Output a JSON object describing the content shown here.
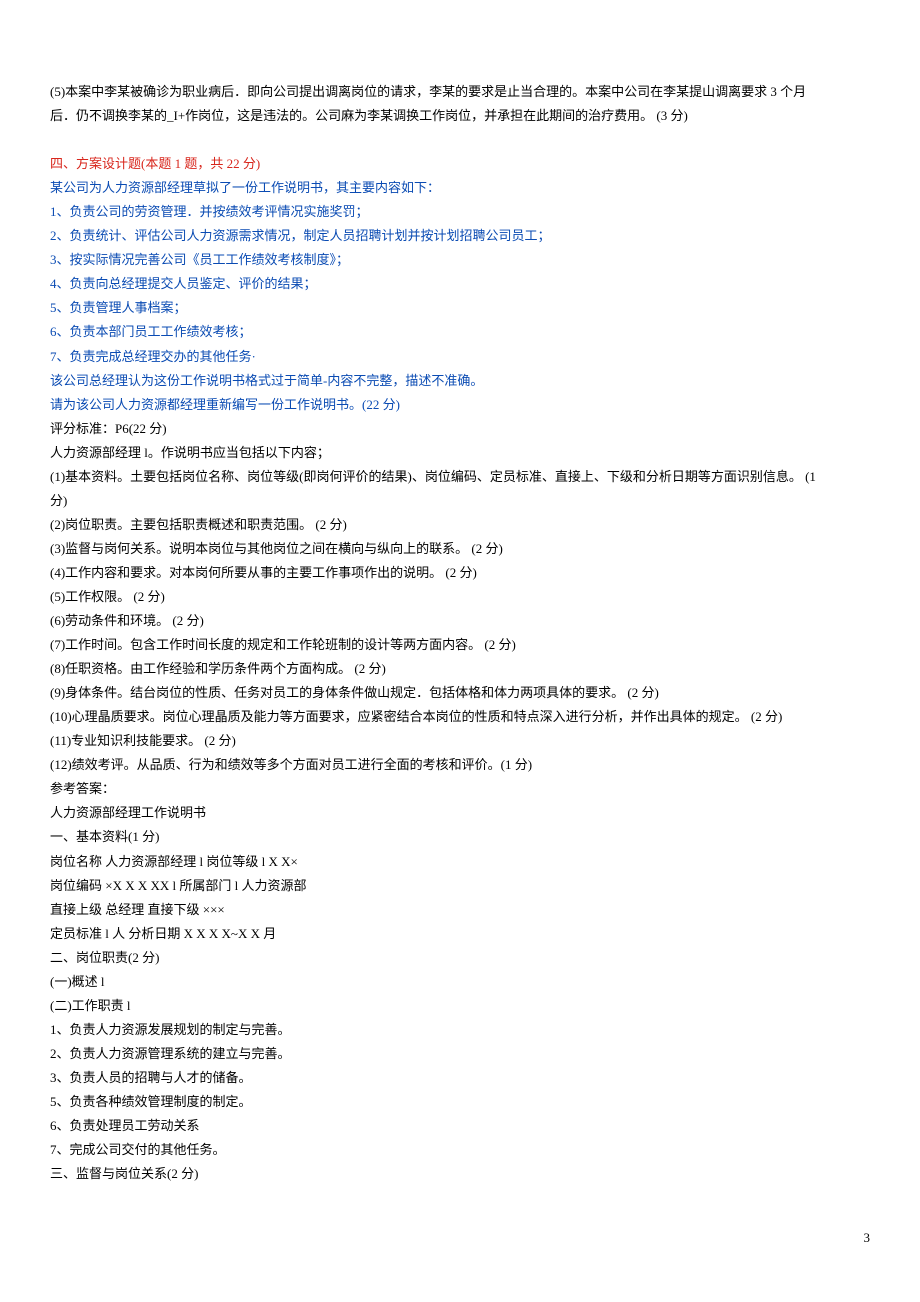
{
  "intro_l1": "(5)本案中李某被确诊为职业病后．即向公司提出调离岗位的请求，李某的要求是止当合理的。本案中公司在李某提山调离要求 3 个月",
  "intro_l2": "后．仍不调换李某的_I+作岗位，这是违法的。公司麻为李某调换工作岗位，并承担在此期间的治疗费用。 (3 分)",
  "section4_title": "四、方案设计题(本题 1 题，共 22 分)",
  "s4_p1": "某公司为人力资源部经理草拟了一份工作说明书，其主要内容如下：",
  "s4_i1": "1、负责公司的劳资管理．并按绩效考评情况实施奖罚；",
  "s4_i2": "2、负责统计、评估公司人力资源需求情况，制定人员招聘计划并按计划招聘公司员工；",
  "s4_i3": "3、按实际情况完善公司《员工工作绩效考核制度》；",
  "s4_i4": "4、负责向总经理提交人员鉴定、评价的结果；",
  "s4_i5": "5、负责管理人事档案；",
  "s4_i6": "6、负责本部门员工工作绩效考核；",
  "s4_i7": "7、负责完成总经理交办的其他任务·",
  "s4_p2": "该公司总经理认为这份工作说明书格式过于简单-内容不完整，描述不准确。",
  "s4_p3": "请为该公司人力资源都经理重新编写一份工作说明书。(22 分)",
  "std_title": "评分标准：P6(22 分)",
  "std_p1": "人力资源部经理 l。作说明书应当包括以下内容；",
  "std_i1a": "(1)基本资料。土要包括岗位名称、岗位等级(即岗何评价的结果)、岗位编码、定员标准、直接上、下级和分析日期等方面识别信息。 (1",
  "std_i1b": "分)",
  "std_i2": "(2)岗位职责。主要包括职责概述和职责范围。 (2 分)",
  "std_i3": "(3)监督与岗何关系。说明本岗位与其他岗位之间在横向与纵向上的联系。 (2 分)",
  "std_i4": "(4)工作内容和要求。对本岗何所要从事的主要工作事项作出的说明。 (2 分)",
  "std_i5": "(5)工作权限。 (2 分)",
  "std_i6": "(6)劳动条件和环境。 (2 分)",
  "std_i7": "(7)工作时间。包含工作时间长度的规定和工作轮班制的设计等两方面内容。 (2 分)",
  "std_i8": "(8)任职资格。由工作经验和学历条件两个方面构成。 (2 分)",
  "std_i9": "(9)身体条件。结台岗位的性质、任务对员工的身体条件做山规定．包括体格和体力两项具体的要求。 (2 分)",
  "std_i10": "(10)心理晶质要求。岗位心理晶质及能力等方面要求，应紧密结合本岗位的性质和特点深入进行分析，并作出具体的规定。 (2 分)",
  "std_i11": "(11)专业知识利技能要求。 (2 分)",
  "std_i12": "(12)绩效考评。从品质、行为和绩效等多个方面对员工进行全面的考核和评价。(1 分)",
  "ans_title": "参考答案：",
  "ans_p1": "人力资源部经理工作说明书",
  "ans_s1": "一、基本资料(1 分)",
  "ans_s1_l1": "岗位名称 人力资源部经理 l 岗位等级 l X X×",
  "ans_s1_l2": "岗位编码 ×X X X XX l 所属部门 l 人力资源部",
  "ans_s1_l3": "直接上级 总经理 直接下级 ×××",
  "ans_s1_l4": "定员标准 l 人 分析日期 X X X X~X X 月",
  "ans_s2": "二、岗位职责(2 分)",
  "ans_s2_l1": "(一)概述 l",
  "ans_s2_l2": "(二)工作职责 l",
  "ans_s2_i1": "1、负责人力资源发展规划的制定与完善。",
  "ans_s2_i2": "2、负责人力资源管理系统的建立与完善。",
  "ans_s2_i3": "3、负责人员的招聘与人才的储备。",
  "ans_s2_i5": "5、负责各种绩效管理制度的制定。",
  "ans_s2_i6": "6、负责处理员工劳动关系",
  "ans_s2_i7": "7、完成公司交付的其他任务。",
  "ans_s3": "三、监督与岗位关系(2 分)",
  "page_num": "3"
}
